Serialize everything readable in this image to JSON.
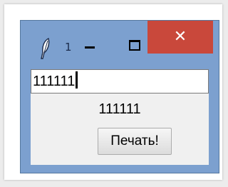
{
  "window": {
    "title": "1",
    "close_glyph": "✕",
    "colors": {
      "frame": "#7ca0cf",
      "close": "#c9483b",
      "client": "#f0f0f0"
    }
  },
  "entry": {
    "value": "111111"
  },
  "label": {
    "text": "111111"
  },
  "button": {
    "label": "Печать!"
  },
  "icons": [
    "feather-icon",
    "minimize-icon",
    "maximize-icon",
    "close-icon"
  ]
}
